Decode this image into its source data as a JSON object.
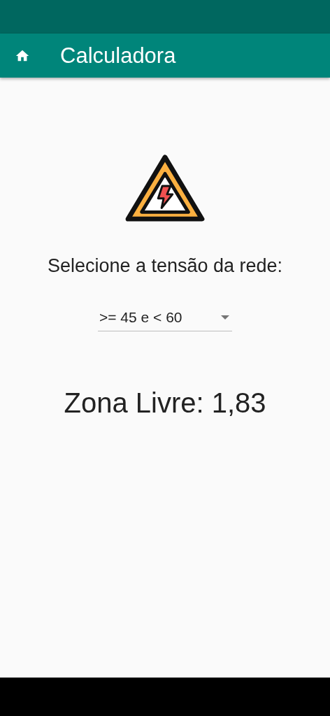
{
  "app_bar": {
    "title": "Calculadora"
  },
  "prompt": "Selecione a tensão da rede:",
  "dropdown": {
    "value": ">= 45 e < 60"
  },
  "result": "Zona Livre: 1,83"
}
